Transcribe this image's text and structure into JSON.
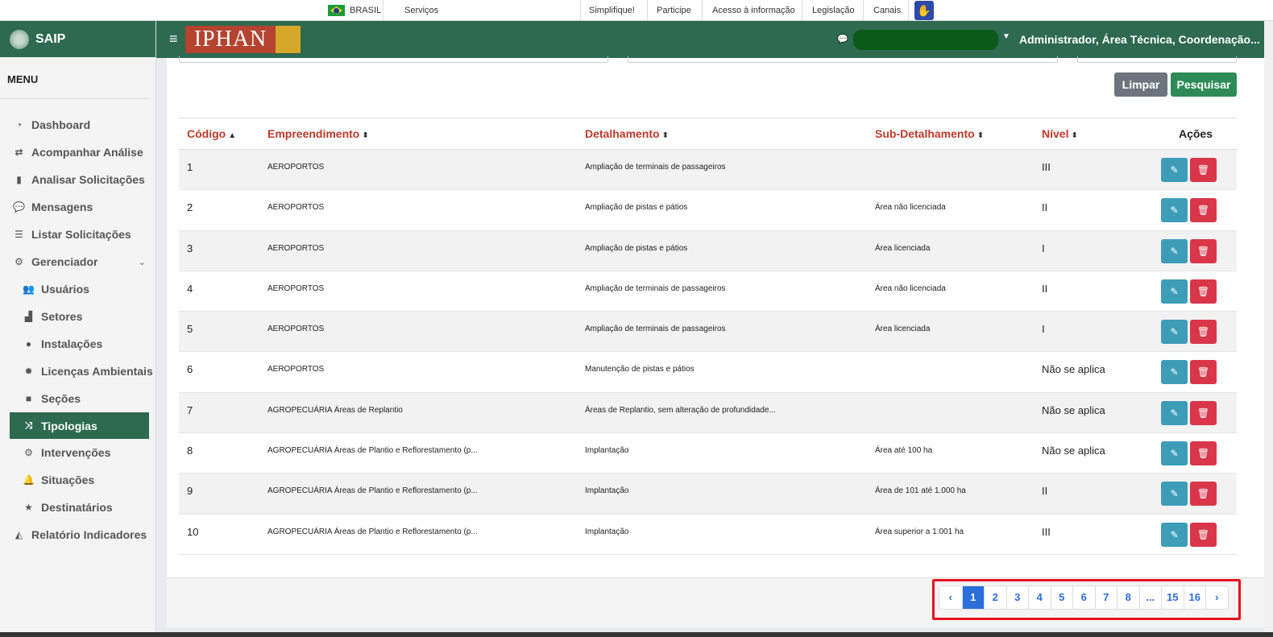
{
  "govbar": {
    "brasil": "BRASIL",
    "servicos": "Serviços",
    "links": [
      "Simplifique!",
      "Participe",
      "Acesso à informação",
      "Legislação",
      "Canais"
    ],
    "accessibility_icon": "hand-sign-icon"
  },
  "sidebar": {
    "brand": "SAIP",
    "menu_title": "MENU",
    "items": [
      {
        "label": "Dashboard",
        "icon": "dashboard-icon",
        "glyph": "◔"
      },
      {
        "label": "Acompanhar Análise",
        "icon": "exchange-icon",
        "glyph": "⇄"
      },
      {
        "label": "Analisar Solicitações",
        "icon": "book-icon",
        "glyph": "▮"
      },
      {
        "label": "Mensagens",
        "icon": "comments-icon",
        "glyph": "💬"
      },
      {
        "label": "Listar Solicitações",
        "icon": "list-icon",
        "glyph": "☰"
      },
      {
        "label": "Gerenciador",
        "icon": "cogs-icon",
        "glyph": "⚙"
      },
      {
        "label": "Usuários",
        "icon": "users-icon",
        "glyph": "👥"
      },
      {
        "label": "Setores",
        "icon": "industry-icon",
        "glyph": "▟"
      },
      {
        "label": "Instalações",
        "icon": "circle-icon",
        "glyph": "●"
      },
      {
        "label": "Licenças Ambientais",
        "icon": "certificate-icon",
        "glyph": "✹"
      },
      {
        "label": "Seções",
        "icon": "square-icon",
        "glyph": "■"
      },
      {
        "label": "Tipologias",
        "icon": "random-icon",
        "glyph": "⤨"
      },
      {
        "label": "Intervenções",
        "icon": "gear-outline-icon",
        "glyph": "⚙"
      },
      {
        "label": "Situações",
        "icon": "bell-icon",
        "glyph": "🔔"
      },
      {
        "label": "Destinatários",
        "icon": "star-icon",
        "glyph": "★"
      },
      {
        "label": "Relatório Indicadores",
        "icon": "area-chart-icon",
        "glyph": "◭"
      }
    ]
  },
  "header": {
    "logo_text": "IPHAN",
    "user": "Administrador, Área Técnica, Coordenação..."
  },
  "buttons": {
    "limpar": "Limpar",
    "pesquisar": "Pesquisar"
  },
  "table": {
    "headers": [
      "Código",
      "Empreendimento",
      "Detalhamento",
      "Sub-Detalhamento",
      "Nível",
      "Ações"
    ],
    "rows": [
      [
        "1",
        "AEROPORTOS",
        "Ampliação de terminais de passageiros",
        "",
        "III"
      ],
      [
        "2",
        "AEROPORTOS",
        "Ampliação de pistas e pátios",
        "Área não licenciada",
        "II"
      ],
      [
        "3",
        "AEROPORTOS",
        "Ampliação de pistas e pátios",
        "Área licenciada",
        "I"
      ],
      [
        "4",
        "AEROPORTOS",
        "Ampliação de terminais de passageiros",
        "Área não licenciada",
        "II"
      ],
      [
        "5",
        "AEROPORTOS",
        "Ampliação de terminais de passageiros",
        "Área licenciada",
        "I"
      ],
      [
        "6",
        "AEROPORTOS",
        "Manutenção de pistas e pátios",
        "",
        "Não se aplica"
      ],
      [
        "7",
        "AGROPECUÁRIA Áreas de Replantio",
        "Áreas de Replantio, sem alteração de profundidade...",
        "",
        "Não se aplica"
      ],
      [
        "8",
        "AGROPECUÁRIA Áreas de Plantio e Reflorestamento (p...",
        "Implantação",
        "Área até 100 ha",
        "Não se aplica"
      ],
      [
        "9",
        "AGROPECUÁRIA Áreas de Plantio e Reflorestamento (p...",
        "Implantação",
        "Área de 101 até 1.000 ha",
        "II"
      ],
      [
        "10",
        "AGROPECUÁRIA Áreas de Plantio e Reflorestamento (p...",
        "Implantação",
        "Área superior a 1.001 ha",
        "III"
      ]
    ]
  },
  "pagination": [
    "‹",
    "1",
    "2",
    "3",
    "4",
    "5",
    "6",
    "7",
    "8",
    "...",
    "15",
    "16",
    "›"
  ],
  "pagination_active": "1",
  "colors": {
    "brand_green": "#2d6a4f",
    "header_red": "#c0392b",
    "edit": "#3d9db8",
    "delete": "#d9364a",
    "highlight": "#e8101f"
  }
}
